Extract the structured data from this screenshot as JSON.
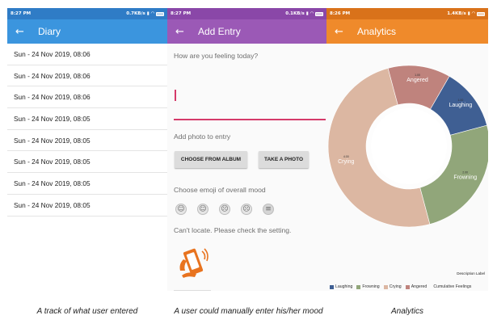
{
  "screens": {
    "diary": {
      "status": {
        "time": "8:27 PM",
        "net": "0.7KB/s"
      },
      "title": "Diary",
      "entries": [
        "Sun - 24 Nov 2019, 08:06",
        "Sun - 24 Nov 2019, 08:06",
        "Sun - 24 Nov 2019, 08:06",
        "Sun - 24 Nov 2019, 08:05",
        "Sun - 24 Nov 2019, 08:05",
        "Sun - 24 Nov 2019, 08:05",
        "Sun - 24 Nov 2019, 08:05",
        "Sun - 24 Nov 2019, 08:05"
      ]
    },
    "add_entry": {
      "status": {
        "time": "8:27 PM",
        "net": "0.1KB/s"
      },
      "title": "Add Entry",
      "prompt": "How are you feeling today?",
      "input_value": "",
      "add_photo_label": "Add photo to entry",
      "choose_album_label": "CHOOSE FROM ALBUM",
      "take_photo_label": "TAKE A PHOTO",
      "emoji_prompt": "Choose emoji of overall mood",
      "emoji_icons": [
        "laughing-emoji-icon",
        "smiling-emoji-icon",
        "sad-emoji-icon",
        "crying-emoji-icon",
        "angry-emoji-icon"
      ],
      "location_text": "Can't locate. Please check the setting."
    },
    "analytics": {
      "status": {
        "time": "8:26 PM",
        "net": "1.4KB/s"
      },
      "title": "Analytics",
      "description_label": "Description Label",
      "cumulative_label": "Cumulative Feelings"
    }
  },
  "chart_data": {
    "type": "pie",
    "donut": true,
    "categories": [
      "Laughing",
      "Frowning",
      "Crying",
      "Angered"
    ],
    "values": [
      1,
      2,
      4,
      1
    ],
    "value_labels": [
      "1.00",
      "2.00",
      "4.00",
      "1.00"
    ],
    "colors": [
      "#3f5f93",
      "#91a67a",
      "#dcb7a2",
      "#bf837d"
    ],
    "legend_position": "bottom-left",
    "description": "Description Label"
  },
  "captions": {
    "diary": "A track of what user entered",
    "add_entry": "A user could manually enter his/her mood",
    "analytics": "Analytics"
  },
  "colors": {
    "diary_bar": "#3b95de",
    "add_entry_bar": "#9b59b6",
    "analytics_bar": "#ef8a2b",
    "input_accent": "#d53a6a"
  }
}
